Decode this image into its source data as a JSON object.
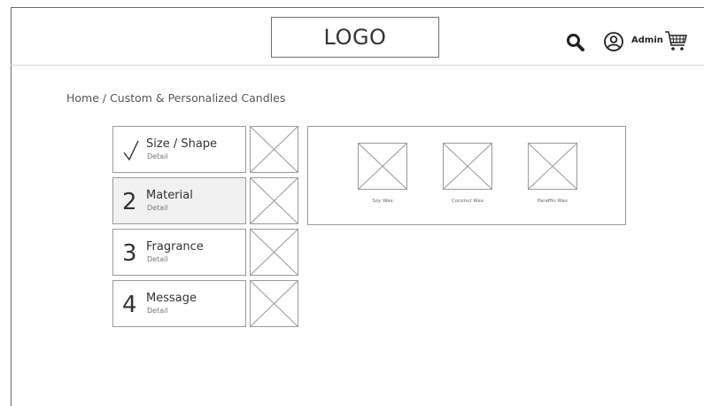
{
  "header": {
    "logo_text": "LOGO",
    "user_label": "Admin",
    "icons": [
      "search-icon",
      "user-icon",
      "cart-icon"
    ]
  },
  "breadcrumb": "Home / Custom & Personalized Candles",
  "steps": [
    {
      "marker": "✓",
      "marker_icon": "check-icon",
      "title": "Size / Shape",
      "detail": "Detail",
      "state": "completed"
    },
    {
      "marker": "2",
      "title": "Material",
      "detail": "Detail",
      "state": "active"
    },
    {
      "marker": "3",
      "title": "Fragrance",
      "detail": "Detail",
      "state": "pending"
    },
    {
      "marker": "4",
      "title": "Message",
      "detail": "Detail",
      "state": "pending"
    }
  ],
  "options": [
    {
      "label": "Soy Wax"
    },
    {
      "label": "Coconut Wax"
    },
    {
      "label": "Paraffin Wax"
    }
  ],
  "colors": {
    "border": "#9a9a9a",
    "active_step_bg": "#f1f1f1",
    "text": "#333333"
  }
}
